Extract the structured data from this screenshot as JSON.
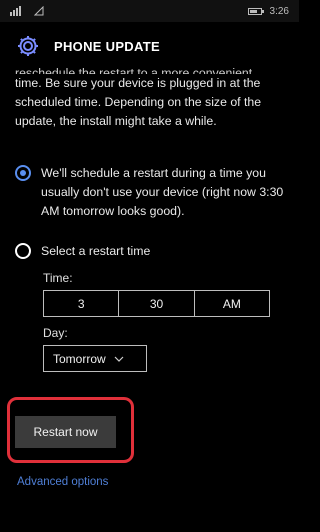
{
  "status_bar": {
    "time": "3:26",
    "battery_level": 0.7
  },
  "header": {
    "title": "PHONE UPDATE",
    "icon": "gear-icon"
  },
  "intro": {
    "clipped_line": "reschedule the restart to a more convenient",
    "text": "time. Be sure your device is plugged in at the scheduled time. Depending on the size of the update, the install might take a while."
  },
  "options": {
    "auto": {
      "selected": true,
      "text": "We'll schedule a restart during a time you usually don't use your device (right now 3:30 AM tomorrow looks good)."
    },
    "manual": {
      "selected": false,
      "text": "Select a restart time"
    }
  },
  "time": {
    "label": "Time:",
    "hour": "3",
    "minute": "30",
    "period": "AM"
  },
  "day": {
    "label": "Day:",
    "selected": "Tomorrow"
  },
  "actions": {
    "restart_now": "Restart now",
    "advanced_options": "Advanced options"
  },
  "colors": {
    "accent": "#5a8ff0",
    "link": "#4f7fd6",
    "highlight": "#e0303a"
  }
}
